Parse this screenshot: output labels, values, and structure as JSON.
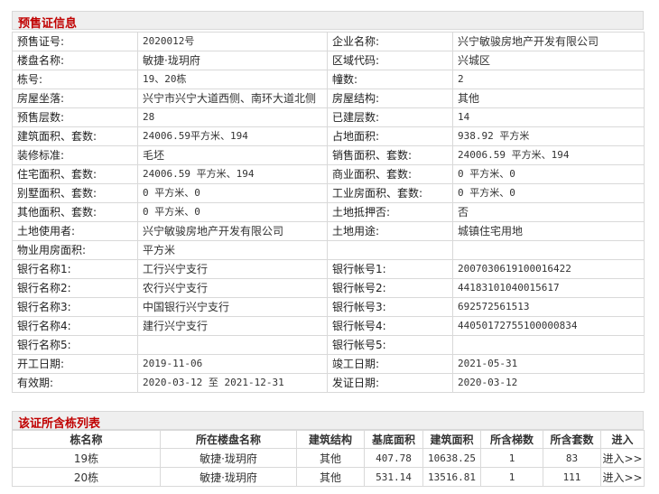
{
  "presale": {
    "title": "预售证信息",
    "rows": [
      [
        {
          "label": "预售证号:",
          "value": "2020012号"
        },
        {
          "label": "企业名称:",
          "value": "兴宁敏骏房地产开发有限公司"
        }
      ],
      [
        {
          "label": "楼盘名称:",
          "value": "敏捷·珑玥府"
        },
        {
          "label": "区域代码:",
          "value": "兴城区"
        }
      ],
      [
        {
          "label": "栋号:",
          "value": "19、20栋"
        },
        {
          "label": "幢数:",
          "value": "2"
        }
      ],
      [
        {
          "label": "房屋坐落:",
          "value": "兴宁市兴宁大道西侧、南环大道北侧"
        },
        {
          "label": "房屋结构:",
          "value": "其他"
        }
      ],
      [
        {
          "label": "预售层数:",
          "value": "28"
        },
        {
          "label": "已建层数:",
          "value": "14"
        }
      ],
      [
        {
          "label": "建筑面积、套数:",
          "value": "24006.59平方米、194"
        },
        {
          "label": "占地面积:",
          "value": "938.92 平方米"
        }
      ],
      [
        {
          "label": "装修标准:",
          "value": "毛坯"
        },
        {
          "label": "销售面积、套数:",
          "value": "24006.59 平方米、194"
        }
      ],
      [
        {
          "label": "住宅面积、套数:",
          "value": "24006.59 平方米、194"
        },
        {
          "label": "商业面积、套数:",
          "value": "0 平方米、0"
        }
      ],
      [
        {
          "label": "别墅面积、套数:",
          "value": "0 平方米、0"
        },
        {
          "label": "工业房面积、套数:",
          "value": "0 平方米、0"
        }
      ],
      [
        {
          "label": "其他面积、套数:",
          "value": "0 平方米、0"
        },
        {
          "label": "土地抵押否:",
          "value": "否"
        }
      ],
      [
        {
          "label": "土地使用者:",
          "value": "兴宁敏骏房地产开发有限公司"
        },
        {
          "label": "土地用途:",
          "value": "城镇住宅用地"
        }
      ],
      [
        {
          "label": "物业用房面积:",
          "value": "平方米"
        },
        {
          "label": "",
          "value": ""
        }
      ],
      [
        {
          "label": "银行名称1:",
          "value": "工行兴宁支行"
        },
        {
          "label": "银行帐号1:",
          "value": "2007030619100016422"
        }
      ],
      [
        {
          "label": "银行名称2:",
          "value": "农行兴宁支行"
        },
        {
          "label": "银行帐号2:",
          "value": "44183101040015617"
        }
      ],
      [
        {
          "label": "银行名称3:",
          "value": "中国银行兴宁支行"
        },
        {
          "label": "银行帐号3:",
          "value": "692572561513"
        }
      ],
      [
        {
          "label": "银行名称4:",
          "value": "建行兴宁支行"
        },
        {
          "label": "银行帐号4:",
          "value": "44050172755100000834"
        }
      ],
      [
        {
          "label": "银行名称5:",
          "value": ""
        },
        {
          "label": "银行帐号5:",
          "value": ""
        }
      ],
      [
        {
          "label": "开工日期:",
          "value": "2019-11-06"
        },
        {
          "label": "竣工日期:",
          "value": "2021-05-31"
        }
      ],
      [
        {
          "label": "有效期:",
          "value": "2020-03-12 至 2021-12-31"
        },
        {
          "label": "发证日期:",
          "value": "2020-03-12"
        }
      ]
    ]
  },
  "buildings": {
    "title": "该证所含栋列表",
    "columns": [
      "栋名称",
      "所在楼盘名称",
      "建筑结构",
      "基底面积",
      "建筑面积",
      "所含梯数",
      "所含套数",
      "进入"
    ],
    "rows": [
      {
        "name": "19栋",
        "project": "敏捷·珑玥府",
        "structure": "其他",
        "base_area": "407.78",
        "build_area": "10638.25",
        "stairs": "1",
        "units": "83",
        "enter": "进入>>"
      },
      {
        "name": "20栋",
        "project": "敏捷·珑玥府",
        "structure": "其他",
        "base_area": "531.14",
        "build_area": "13516.81",
        "stairs": "1",
        "units": "111",
        "enter": "进入>>"
      }
    ]
  }
}
